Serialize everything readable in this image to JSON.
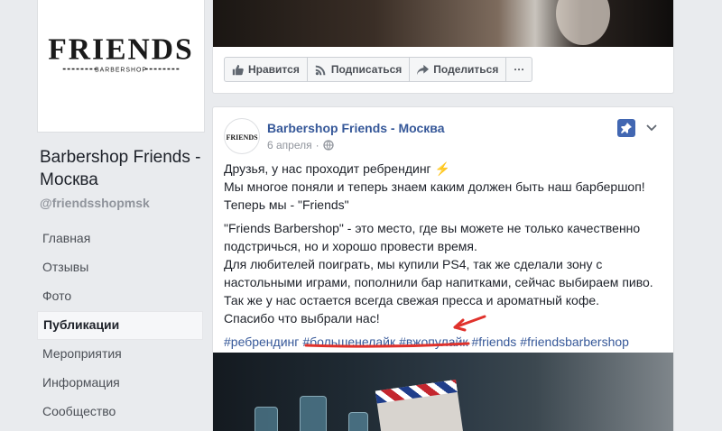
{
  "sidebar": {
    "logo_text": "FRIENDS",
    "logo_sub": "BARBERSHOP",
    "page_name": "Barbershop Friends - Москва",
    "handle": "@friendsshopmsk",
    "nav": [
      "Главная",
      "Отзывы",
      "Фото",
      "Публикации",
      "Мероприятия",
      "Информация",
      "Сообщество"
    ],
    "active_index": 3
  },
  "prev_post": {
    "actions": {
      "like": "Нравится",
      "subscribe": "Подписаться",
      "share": "Поделиться",
      "more": "···"
    }
  },
  "post": {
    "avatar_text": "FRIENDS",
    "author": "Barbershop Friends - Москва",
    "date": "6 апреля",
    "dot": "·",
    "paragraph1": [
      "Друзья, у нас проходит ребрендинг",
      "Мы многое поняли и теперь знаем каким должен быть наш барбершоп!",
      "Теперь мы - \"Friends\""
    ],
    "emoji": "⚡",
    "paragraph2": [
      "\"Friends Barbershop\" - это место, где вы можете не только качественно подстричься, но и хорошо провести время.",
      "Для любителей поиграть, мы купили PS4, так же сделали зону с настольными играми, пополнили бар напитками, сейчас выбираем пиво.",
      "Так же у нас остается всегда свежая пресса и ароматный кофе.",
      "Спасибо что выбрали нас!"
    ],
    "hashtags": [
      "#ребрендинг",
      "#большенелайк",
      "#вжопулайк",
      "#friends",
      "#friendsbarbershop"
    ]
  },
  "colors": {
    "link": "#365899",
    "annotation": "#e0322c",
    "pin": "#4267b2"
  }
}
